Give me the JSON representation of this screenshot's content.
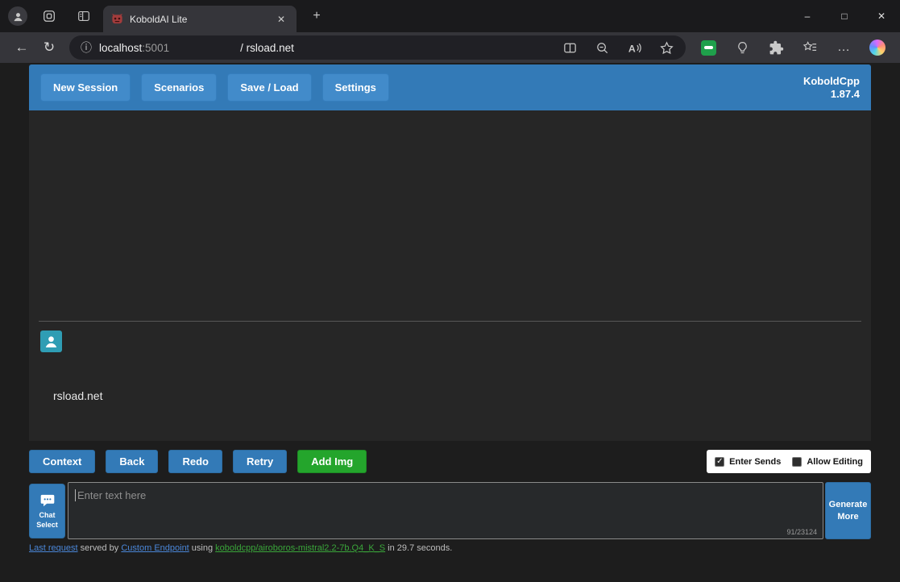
{
  "colors": {
    "topmenu_blue": "#337ab7",
    "button_primary": "#428bca",
    "button_success": "#24a52c",
    "gametext_bg": "#262626",
    "avatar_teal": "#2f9db4",
    "link_blue": "#4a86d8",
    "link_green": "#3aa63a",
    "panel_white": "#ffffff"
  },
  "icons": {
    "back": "←",
    "refresh": "↻",
    "info": "ⓘ",
    "plus": "+",
    "tab_close": "✕",
    "minimize": "–",
    "maximize": "□",
    "window_close": "✕",
    "more": "…"
  },
  "browser": {
    "tab_title": "KoboldAI Lite",
    "address": {
      "host": "localhost",
      "port": ":5001",
      "path": "/ rsload.net"
    }
  },
  "topmenu": {
    "buttons": [
      {
        "label": "New Session"
      },
      {
        "label": "Scenarios"
      },
      {
        "label": "Save / Load"
      },
      {
        "label": "Settings"
      }
    ],
    "version_line1": "KoboldCpp",
    "version_line2": "1.87.4"
  },
  "chat": {
    "message": "rsload.net"
  },
  "actions": {
    "buttons": [
      {
        "label": "Context",
        "style": "primary"
      },
      {
        "label": "Back",
        "style": "primary"
      },
      {
        "label": "Redo",
        "style": "primary"
      },
      {
        "label": "Retry",
        "style": "primary"
      },
      {
        "label": "Add Img",
        "style": "success"
      }
    ],
    "checkboxes": [
      {
        "label": "Enter Sends",
        "checked": true
      },
      {
        "label": "Allow Editing",
        "checked": false
      }
    ]
  },
  "input": {
    "chat_select_line1": "Chat",
    "chat_select_line2": "Select",
    "placeholder": "Enter text here",
    "value": "",
    "token_counter": "91/23124",
    "generate_line1": "Generate",
    "generate_line2": "More"
  },
  "status": {
    "segments": [
      {
        "text": "Last request",
        "type": "link-blue"
      },
      {
        "text": " served by ",
        "type": "plain"
      },
      {
        "text": "Custom Endpoint",
        "type": "link-blue"
      },
      {
        "text": " using ",
        "type": "plain"
      },
      {
        "text": "koboldcpp/airoboros-mistral2.2-7b.Q4_K_S",
        "type": "link-green"
      },
      {
        "text": " in 29.7 seconds.",
        "type": "plain"
      }
    ]
  }
}
